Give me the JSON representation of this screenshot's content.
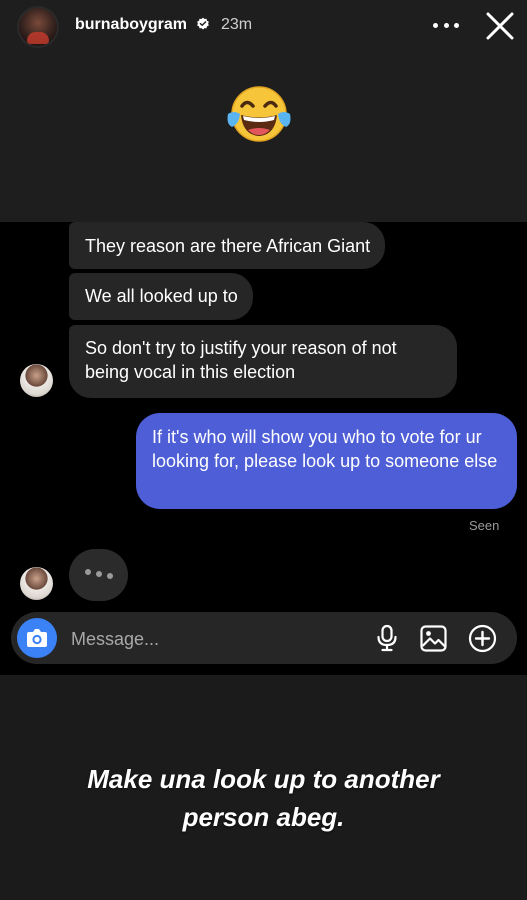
{
  "header": {
    "username": "burnaboygram",
    "time": "23m",
    "verified": true,
    "avatar_icon": "avatar",
    "more_icon": "more-icon",
    "close_icon": "close-icon"
  },
  "sticker": {
    "emoji": "😂",
    "icon": "face-with-tears-of-joy-icon"
  },
  "chat": {
    "received": [
      "They reason are there African Giant",
      "We all looked up to",
      "So don't try to justify your reason of not being vocal in this election"
    ],
    "sent": "If it's who will show you who to vote for ur looking for, please look up to someone else",
    "seen_label": "Seen"
  },
  "composer": {
    "placeholder": "Message...",
    "icons": [
      "camera-icon",
      "microphone-icon",
      "gallery-icon",
      "plus-circle-icon"
    ]
  },
  "caption": {
    "line1": "Make una look up to another",
    "line2": "person abeg."
  },
  "colors": {
    "sent_bubble": "#4e5ed6",
    "received_bubble": "#262626",
    "camera_button": "#3b82f6"
  }
}
